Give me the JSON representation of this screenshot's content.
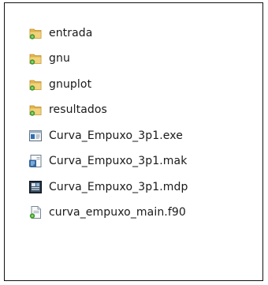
{
  "explorer": {
    "items": [
      {
        "name": "entrada",
        "kind": "folder",
        "icon": "folder-icon"
      },
      {
        "name": "gnu",
        "kind": "folder",
        "icon": "folder-icon"
      },
      {
        "name": "gnuplot",
        "kind": "folder",
        "icon": "folder-icon"
      },
      {
        "name": "resultados",
        "kind": "folder",
        "icon": "folder-icon"
      },
      {
        "name": "Curva_Empuxo_3p1.exe",
        "kind": "file",
        "icon": "exe-file-icon"
      },
      {
        "name": "Curva_Empuxo_3p1.mak",
        "kind": "file",
        "icon": "mak-file-icon"
      },
      {
        "name": "Curva_Empuxo_3p1.mdp",
        "kind": "file",
        "icon": "mdp-file-icon"
      },
      {
        "name": "curva_empuxo_main.f90",
        "kind": "file",
        "icon": "f90-file-icon"
      }
    ]
  },
  "colors": {
    "folder_body": "#e8b94a",
    "folder_tab": "#f2d27a",
    "green_accent": "#3f9a2f",
    "border": "#111111"
  }
}
